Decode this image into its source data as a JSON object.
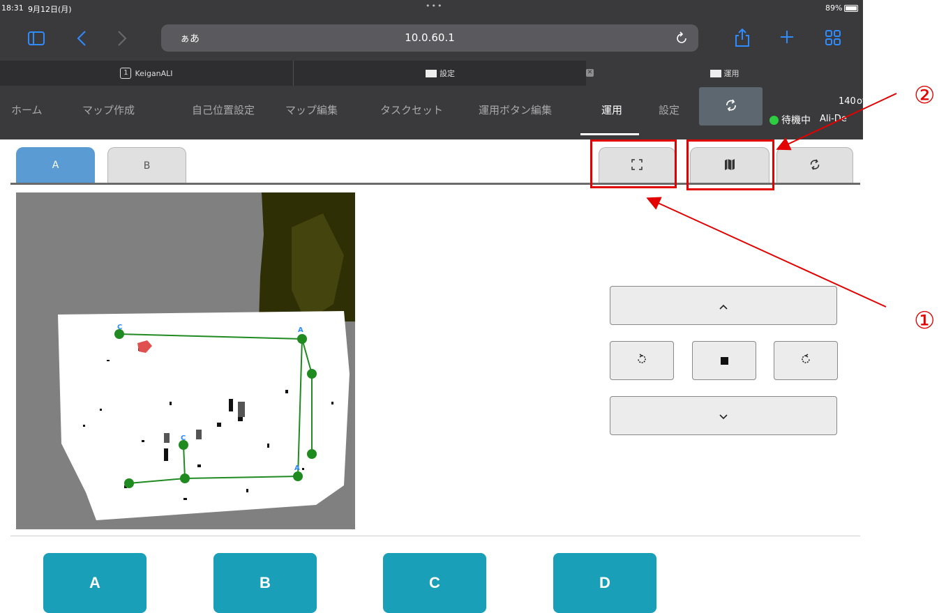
{
  "status_bar": {
    "time": "18:31",
    "date": "9月12日(月)",
    "battery": "89%"
  },
  "browser": {
    "url_prefix": "ぁあ",
    "url": "10.0.60.1",
    "tabs": [
      {
        "label": "KeiganALI",
        "icon": "tab-number-1-icon"
      },
      {
        "label": "設定",
        "icon": "tab-favicon"
      },
      {
        "label": "運用",
        "icon": "tab-favicon"
      }
    ]
  },
  "app_nav": {
    "items": [
      "ホーム",
      "マップ作成",
      "自己位置設定",
      "マップ編集",
      "タスクセット",
      "運用ボタン編集",
      "運用",
      "設定"
    ],
    "active": "運用",
    "status_number": "140",
    "status_unit": "off",
    "status_text": "待機中",
    "robot_name": "Ali-De",
    "status_color": "#2ecc40"
  },
  "content": {
    "tabs": [
      "A",
      "B"
    ],
    "active_tab": "A",
    "toolbar_icons": [
      "fullscreen-icon",
      "map-icon",
      "refresh-icon"
    ],
    "action_buttons": [
      "A",
      "B",
      "C",
      "D"
    ],
    "accent_color": "#1a9fb8",
    "tab_color": "#5a9bd4"
  },
  "map": {
    "waypoint_labels": [
      "C",
      "A",
      "C",
      "A"
    ],
    "route_color": "#1f8a1f",
    "robot_color": "#e05050"
  },
  "annotations": {
    "label_1": "①",
    "label_2": "②",
    "color": "#e30000"
  }
}
